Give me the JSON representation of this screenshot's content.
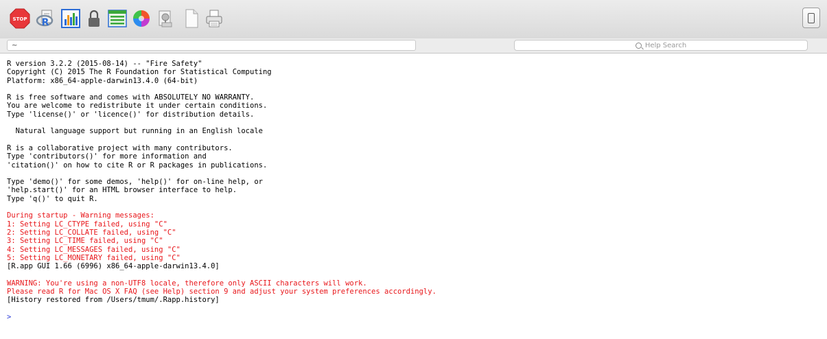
{
  "toolbar": {
    "stop_label": "STOP",
    "colors": {
      "stop": "#e8373a",
      "accent_blue": "#2c6cd6",
      "chart_green": "#3aa83a",
      "chart_orange": "#f29a1a"
    },
    "icons": [
      "stop-icon",
      "r-source-icon",
      "quartz-chart-icon",
      "lock-icon",
      "data-editor-icon",
      "color-wheel-icon",
      "preferences-icon",
      "new-document-icon",
      "print-icon",
      "drawer-icon"
    ]
  },
  "pathbar": {
    "working_dir": "~",
    "help_placeholder": "Help Search"
  },
  "console": {
    "lines": [
      {
        "t": "R version 3.2.2 (2015-08-14) -- \"Fire Safety\"",
        "c": "normal"
      },
      {
        "t": "Copyright (C) 2015 The R Foundation for Statistical Computing",
        "c": "normal"
      },
      {
        "t": "Platform: x86_64-apple-darwin13.4.0 (64-bit)",
        "c": "normal"
      },
      {
        "t": "",
        "c": "blank"
      },
      {
        "t": "R is free software and comes with ABSOLUTELY NO WARRANTY.",
        "c": "normal"
      },
      {
        "t": "You are welcome to redistribute it under certain conditions.",
        "c": "normal"
      },
      {
        "t": "Type 'license()' or 'licence()' for distribution details.",
        "c": "normal"
      },
      {
        "t": "",
        "c": "blank"
      },
      {
        "t": "  Natural language support but running in an English locale",
        "c": "normal"
      },
      {
        "t": "",
        "c": "blank"
      },
      {
        "t": "R is a collaborative project with many contributors.",
        "c": "normal"
      },
      {
        "t": "Type 'contributors()' for more information and",
        "c": "normal"
      },
      {
        "t": "'citation()' on how to cite R or R packages in publications.",
        "c": "normal"
      },
      {
        "t": "",
        "c": "blank"
      },
      {
        "t": "Type 'demo()' for some demos, 'help()' for on-line help, or",
        "c": "normal"
      },
      {
        "t": "'help.start()' for an HTML browser interface to help.",
        "c": "normal"
      },
      {
        "t": "Type 'q()' to quit R.",
        "c": "normal"
      },
      {
        "t": "",
        "c": "blank"
      },
      {
        "t": "During startup - Warning messages:",
        "c": "warn"
      },
      {
        "t": "1: Setting LC_CTYPE failed, using \"C\"",
        "c": "warn"
      },
      {
        "t": "2: Setting LC_COLLATE failed, using \"C\"",
        "c": "warn"
      },
      {
        "t": "3: Setting LC_TIME failed, using \"C\"",
        "c": "warn"
      },
      {
        "t": "4: Setting LC_MESSAGES failed, using \"C\"",
        "c": "warn"
      },
      {
        "t": "5: Setting LC_MONETARY failed, using \"C\"",
        "c": "warn"
      },
      {
        "t": "[R.app GUI 1.66 (6996) x86_64-apple-darwin13.4.0]",
        "c": "normal"
      },
      {
        "t": "",
        "c": "blank"
      },
      {
        "t": "WARNING: You're using a non-UTF8 locale, therefore only ASCII characters will work.",
        "c": "warn"
      },
      {
        "t": "Please read R for Mac OS X FAQ (see Help) section 9 and adjust your system preferences accordingly.",
        "c": "warn"
      },
      {
        "t": "[History restored from /Users/tmum/.Rapp.history]",
        "c": "normal"
      },
      {
        "t": "",
        "c": "blank"
      }
    ],
    "prompt": ">",
    "prompt_color": "#2b3bd8"
  }
}
